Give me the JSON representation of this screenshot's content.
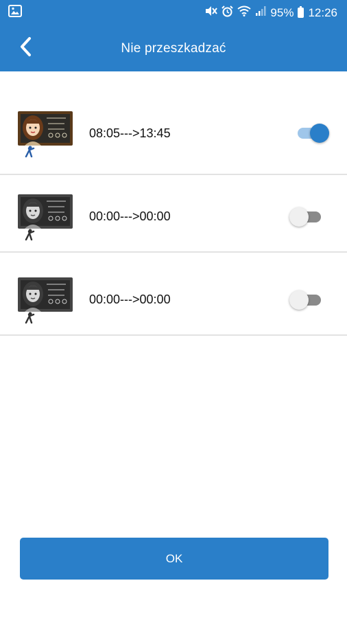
{
  "status_bar": {
    "battery": "95%",
    "time": "12:26",
    "icons": [
      "image-notification-icon",
      "mute-icon",
      "alarm-icon",
      "wifi-icon",
      "signal-icon",
      "battery-icon"
    ]
  },
  "header": {
    "title": "Nie przeszkadzać",
    "back_icon": "chevron-left-icon",
    "color": "#2a7fc9"
  },
  "schedules": [
    {
      "time_range": "08:05--->13:45",
      "enabled": true,
      "icon": "teacher-chalkboard-icon"
    },
    {
      "time_range": "00:00--->00:00",
      "enabled": false,
      "icon": "teacher-chalkboard-icon"
    },
    {
      "time_range": "00:00--->00:00",
      "enabled": false,
      "icon": "teacher-chalkboard-icon"
    }
  ],
  "ok_button": {
    "label": "OK"
  }
}
